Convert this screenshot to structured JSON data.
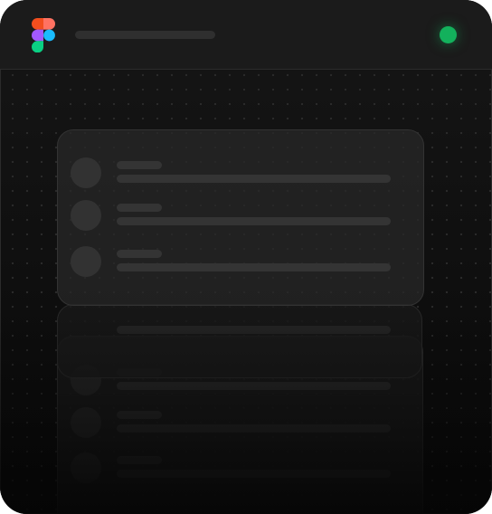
{
  "app": {
    "logo_icon": "figma-logo-icon",
    "status_color": "#13b15c"
  },
  "colors": {
    "background": "#0d0d0d",
    "titlebar": "#1b1b1b",
    "card": "#282828",
    "skeleton": "#343434"
  }
}
